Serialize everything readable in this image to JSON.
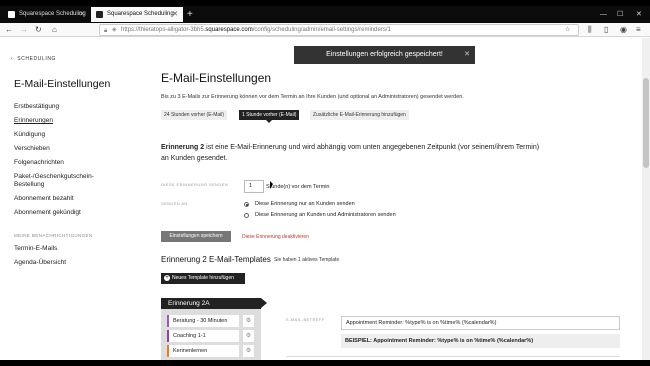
{
  "browser": {
    "tabs": [
      {
        "title": "Squarespace Scheduling",
        "active": false
      },
      {
        "title": "Squarespace Scheduling",
        "active": true
      }
    ],
    "url_prefix": "https://thieratops-alligator-3bh5.",
    "url_domain": "squarespace.com",
    "url_suffix": "/config/scheduling/admin/email-settings/reminders/1"
  },
  "sidebar": {
    "back_label": "SCHEDULING",
    "title": "E-Mail-Einstellungen",
    "items": [
      {
        "label": "Erstbestätigung",
        "selected": false
      },
      {
        "label": "Erinnerungen",
        "selected": true
      },
      {
        "label": "Kündigung",
        "selected": false
      },
      {
        "label": "Verschieben",
        "selected": false
      },
      {
        "label": "Folgenachrichten",
        "selected": false
      },
      {
        "label": "Paket-/Geschenkgutschein-",
        "selected": false
      },
      {
        "label": "Bestellung",
        "selected": false
      },
      {
        "label": "Abonnement bezahlt",
        "selected": false
      },
      {
        "label": "Abonnement gekündigt",
        "selected": false
      }
    ],
    "section_label": "MEINE BENACHRICHTIGUNGEN",
    "more_items": [
      {
        "label": "Termin-E-Mails"
      },
      {
        "label": "Agenda-Übersicht"
      }
    ]
  },
  "main": {
    "toast": "Einstellungen erfolgreich gespeichert!",
    "title": "E-Mail-Einstellungen",
    "intro": "Bis zu 3 E-Mails zur Erinnerung können vor dem Termin an Ihre Kunden (und optional an Administratoren) gesendet werden.",
    "reminder_tabs": [
      {
        "label": "24 Stunden vorher (E-Mail)",
        "active": false
      },
      {
        "label": "1 Stunde vorher (E-Mail)",
        "active": true
      },
      {
        "label": "Zusätzliche E-Mail-Erinnerung hinzufügen",
        "active": false
      }
    ],
    "description_bold": "Erinnerung 2",
    "description": " ist eine E-Mail-Erinnerung und wird abhängig vom unten angegebenen Zeitpunkt (vor seinem/ihrem Termin) an Kunden gesendet.",
    "send_label": "DIESE ERINNERUNG SENDEN",
    "send_value": "1",
    "send_unit": "Stunde(n) vor dem Termin",
    "send_to_label": "SENDEN AN",
    "radio_options": [
      {
        "label": "Diese Erinnerung nur an Kunden senden",
        "checked": true
      },
      {
        "label": "Diese Erinnerung an Kunden und Administratoren senden",
        "checked": false
      }
    ],
    "save_button": "Einstellungen speichern",
    "deactivate_link": "Diese Erinnerung deaktivieren",
    "templates_title": "Erinnerung 2 E-Mail-Templates",
    "templates_subtitle": "Sie haben 1 aktives Template",
    "new_template_button": "Neues Template hinzufügen",
    "reminder_header": "Erinnerung 2A",
    "template_items": [
      {
        "label": "Beratung - 30 Minuten",
        "color": "#9b59b6"
      },
      {
        "label": "Coaching 1-1",
        "color": "#8e44ad"
      },
      {
        "label": "Kennenlernen",
        "color": "#e67e22"
      }
    ],
    "subject_label": "E-MAIL-BETREFF",
    "subject_value": "Appointment Reminder: %type% is on %time% (%calendar%)",
    "example_value": "BEISPIEL: Appointment Reminder: %type% is on %time% (%calendar%)"
  }
}
